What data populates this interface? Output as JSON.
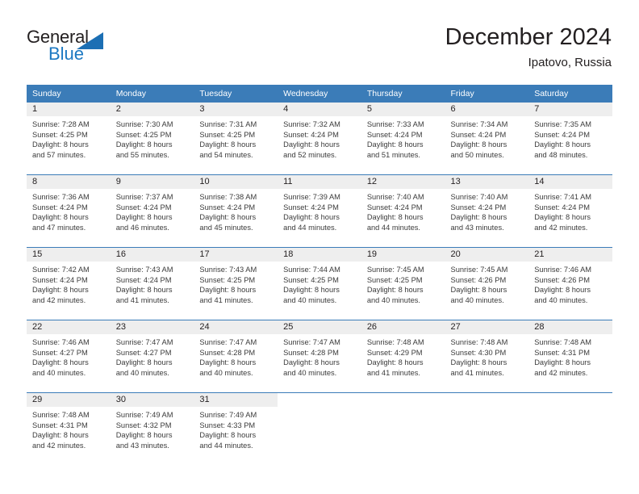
{
  "logo": {
    "word_top": "General",
    "word_bottom": "Blue",
    "triangle_color": "#1c6fb4",
    "blue_color": "#1c78c2"
  },
  "header": {
    "title": "December 2024",
    "subtitle": "Ipatovo, Russia"
  },
  "theme": {
    "header_blue": "#3b7cb8",
    "daynum_band": "#eeeeee",
    "text": "#231f20"
  },
  "calendar": {
    "weekdays": [
      "Sunday",
      "Monday",
      "Tuesday",
      "Wednesday",
      "Thursday",
      "Friday",
      "Saturday"
    ],
    "weeks": [
      [
        {
          "day": "1",
          "sunrise": "Sunrise: 7:28 AM",
          "sunset": "Sunset: 4:25 PM",
          "daylight1": "Daylight: 8 hours",
          "daylight2": "and 57 minutes."
        },
        {
          "day": "2",
          "sunrise": "Sunrise: 7:30 AM",
          "sunset": "Sunset: 4:25 PM",
          "daylight1": "Daylight: 8 hours",
          "daylight2": "and 55 minutes."
        },
        {
          "day": "3",
          "sunrise": "Sunrise: 7:31 AM",
          "sunset": "Sunset: 4:25 PM",
          "daylight1": "Daylight: 8 hours",
          "daylight2": "and 54 minutes."
        },
        {
          "day": "4",
          "sunrise": "Sunrise: 7:32 AM",
          "sunset": "Sunset: 4:24 PM",
          "daylight1": "Daylight: 8 hours",
          "daylight2": "and 52 minutes."
        },
        {
          "day": "5",
          "sunrise": "Sunrise: 7:33 AM",
          "sunset": "Sunset: 4:24 PM",
          "daylight1": "Daylight: 8 hours",
          "daylight2": "and 51 minutes."
        },
        {
          "day": "6",
          "sunrise": "Sunrise: 7:34 AM",
          "sunset": "Sunset: 4:24 PM",
          "daylight1": "Daylight: 8 hours",
          "daylight2": "and 50 minutes."
        },
        {
          "day": "7",
          "sunrise": "Sunrise: 7:35 AM",
          "sunset": "Sunset: 4:24 PM",
          "daylight1": "Daylight: 8 hours",
          "daylight2": "and 48 minutes."
        }
      ],
      [
        {
          "day": "8",
          "sunrise": "Sunrise: 7:36 AM",
          "sunset": "Sunset: 4:24 PM",
          "daylight1": "Daylight: 8 hours",
          "daylight2": "and 47 minutes."
        },
        {
          "day": "9",
          "sunrise": "Sunrise: 7:37 AM",
          "sunset": "Sunset: 4:24 PM",
          "daylight1": "Daylight: 8 hours",
          "daylight2": "and 46 minutes."
        },
        {
          "day": "10",
          "sunrise": "Sunrise: 7:38 AM",
          "sunset": "Sunset: 4:24 PM",
          "daylight1": "Daylight: 8 hours",
          "daylight2": "and 45 minutes."
        },
        {
          "day": "11",
          "sunrise": "Sunrise: 7:39 AM",
          "sunset": "Sunset: 4:24 PM",
          "daylight1": "Daylight: 8 hours",
          "daylight2": "and 44 minutes."
        },
        {
          "day": "12",
          "sunrise": "Sunrise: 7:40 AM",
          "sunset": "Sunset: 4:24 PM",
          "daylight1": "Daylight: 8 hours",
          "daylight2": "and 44 minutes."
        },
        {
          "day": "13",
          "sunrise": "Sunrise: 7:40 AM",
          "sunset": "Sunset: 4:24 PM",
          "daylight1": "Daylight: 8 hours",
          "daylight2": "and 43 minutes."
        },
        {
          "day": "14",
          "sunrise": "Sunrise: 7:41 AM",
          "sunset": "Sunset: 4:24 PM",
          "daylight1": "Daylight: 8 hours",
          "daylight2": "and 42 minutes."
        }
      ],
      [
        {
          "day": "15",
          "sunrise": "Sunrise: 7:42 AM",
          "sunset": "Sunset: 4:24 PM",
          "daylight1": "Daylight: 8 hours",
          "daylight2": "and 42 minutes."
        },
        {
          "day": "16",
          "sunrise": "Sunrise: 7:43 AM",
          "sunset": "Sunset: 4:24 PM",
          "daylight1": "Daylight: 8 hours",
          "daylight2": "and 41 minutes."
        },
        {
          "day": "17",
          "sunrise": "Sunrise: 7:43 AM",
          "sunset": "Sunset: 4:25 PM",
          "daylight1": "Daylight: 8 hours",
          "daylight2": "and 41 minutes."
        },
        {
          "day": "18",
          "sunrise": "Sunrise: 7:44 AM",
          "sunset": "Sunset: 4:25 PM",
          "daylight1": "Daylight: 8 hours",
          "daylight2": "and 40 minutes."
        },
        {
          "day": "19",
          "sunrise": "Sunrise: 7:45 AM",
          "sunset": "Sunset: 4:25 PM",
          "daylight1": "Daylight: 8 hours",
          "daylight2": "and 40 minutes."
        },
        {
          "day": "20",
          "sunrise": "Sunrise: 7:45 AM",
          "sunset": "Sunset: 4:26 PM",
          "daylight1": "Daylight: 8 hours",
          "daylight2": "and 40 minutes."
        },
        {
          "day": "21",
          "sunrise": "Sunrise: 7:46 AM",
          "sunset": "Sunset: 4:26 PM",
          "daylight1": "Daylight: 8 hours",
          "daylight2": "and 40 minutes."
        }
      ],
      [
        {
          "day": "22",
          "sunrise": "Sunrise: 7:46 AM",
          "sunset": "Sunset: 4:27 PM",
          "daylight1": "Daylight: 8 hours",
          "daylight2": "and 40 minutes."
        },
        {
          "day": "23",
          "sunrise": "Sunrise: 7:47 AM",
          "sunset": "Sunset: 4:27 PM",
          "daylight1": "Daylight: 8 hours",
          "daylight2": "and 40 minutes."
        },
        {
          "day": "24",
          "sunrise": "Sunrise: 7:47 AM",
          "sunset": "Sunset: 4:28 PM",
          "daylight1": "Daylight: 8 hours",
          "daylight2": "and 40 minutes."
        },
        {
          "day": "25",
          "sunrise": "Sunrise: 7:47 AM",
          "sunset": "Sunset: 4:28 PM",
          "daylight1": "Daylight: 8 hours",
          "daylight2": "and 40 minutes."
        },
        {
          "day": "26",
          "sunrise": "Sunrise: 7:48 AM",
          "sunset": "Sunset: 4:29 PM",
          "daylight1": "Daylight: 8 hours",
          "daylight2": "and 41 minutes."
        },
        {
          "day": "27",
          "sunrise": "Sunrise: 7:48 AM",
          "sunset": "Sunset: 4:30 PM",
          "daylight1": "Daylight: 8 hours",
          "daylight2": "and 41 minutes."
        },
        {
          "day": "28",
          "sunrise": "Sunrise: 7:48 AM",
          "sunset": "Sunset: 4:31 PM",
          "daylight1": "Daylight: 8 hours",
          "daylight2": "and 42 minutes."
        }
      ],
      [
        {
          "day": "29",
          "sunrise": "Sunrise: 7:48 AM",
          "sunset": "Sunset: 4:31 PM",
          "daylight1": "Daylight: 8 hours",
          "daylight2": "and 42 minutes."
        },
        {
          "day": "30",
          "sunrise": "Sunrise: 7:49 AM",
          "sunset": "Sunset: 4:32 PM",
          "daylight1": "Daylight: 8 hours",
          "daylight2": "and 43 minutes."
        },
        {
          "day": "31",
          "sunrise": "Sunrise: 7:49 AM",
          "sunset": "Sunset: 4:33 PM",
          "daylight1": "Daylight: 8 hours",
          "daylight2": "and 44 minutes."
        },
        {
          "day": "",
          "sunrise": "",
          "sunset": "",
          "daylight1": "",
          "daylight2": ""
        },
        {
          "day": "",
          "sunrise": "",
          "sunset": "",
          "daylight1": "",
          "daylight2": ""
        },
        {
          "day": "",
          "sunrise": "",
          "sunset": "",
          "daylight1": "",
          "daylight2": ""
        },
        {
          "day": "",
          "sunrise": "",
          "sunset": "",
          "daylight1": "",
          "daylight2": ""
        }
      ]
    ]
  }
}
